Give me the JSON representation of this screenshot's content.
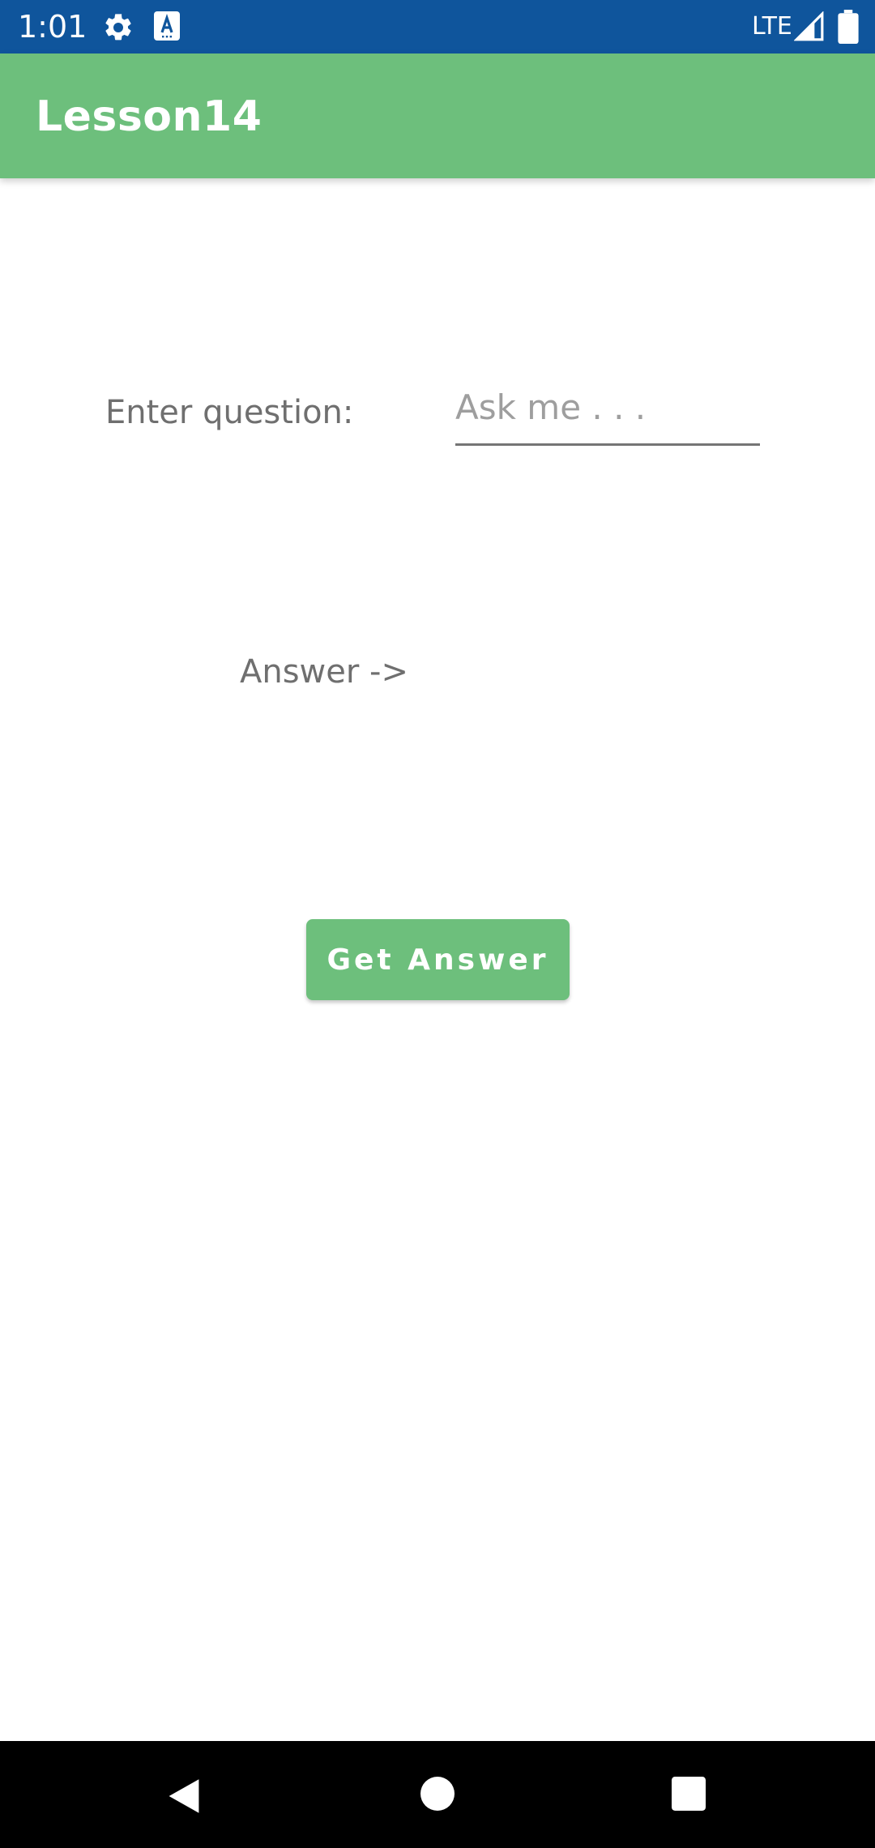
{
  "status_bar": {
    "time": "1:01",
    "network": "LTE",
    "icons": [
      "gear-icon",
      "accessibility-a-icon",
      "signal-icon",
      "battery-icon"
    ]
  },
  "app_bar": {
    "title": "Lesson14"
  },
  "form": {
    "question_label": "Enter question:",
    "question_placeholder": "Ask me . . .",
    "question_value": "",
    "answer_label": "Answer ->",
    "button_label": "Get Answer"
  },
  "nav_bar": {
    "icons": [
      "back-icon",
      "home-icon",
      "recents-icon"
    ]
  },
  "colors": {
    "status_bar": "#0f559c",
    "app_bar": "#6dbf7c",
    "button": "#6dbf7c",
    "label_text": "#6f6f6f",
    "placeholder_text": "#9e9e9e"
  }
}
